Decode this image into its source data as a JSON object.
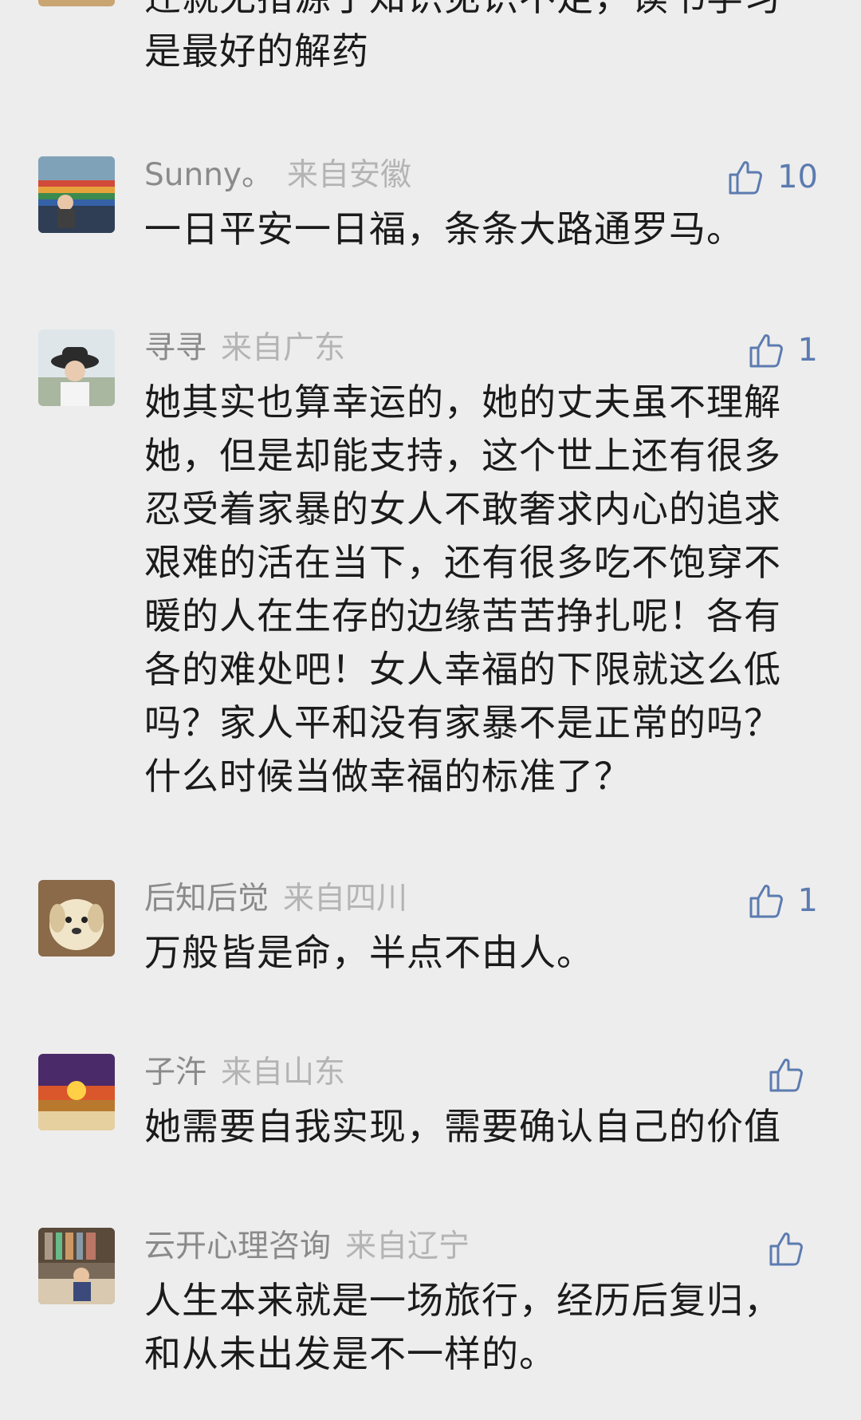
{
  "previous_comment": {
    "text": "迁就无措源于知识见识不足，读书学习\n是最好的解药"
  },
  "comments": [
    {
      "nickname": "Sunny。",
      "location": "来自安徽",
      "likes": "10",
      "text": "一日平安一日福，条条大路通罗马。"
    },
    {
      "nickname": "寻寻",
      "location": "来自广东",
      "likes": "1",
      "text": "她其实也算幸运的，她的丈夫虽不理解\n她，但是却能支持，这个世上还有很多\n忍受着家暴的女人不敢奢求内心的追求\n艰难的活在当下，还有很多吃不饱穿不\n暖的人在生存的边缘苦苦挣扎呢！各有\n各的难处吧！女人幸福的下限就这么低\n吗？家人平和没有家暴不是正常的吗？\n什么时候当做幸福的标准了？"
    },
    {
      "nickname": "后知后觉",
      "location": "来自四川",
      "likes": "1",
      "text": "万般皆是命，半点不由人。"
    },
    {
      "nickname": "子汻",
      "location": "来自山东",
      "likes": "",
      "text": "她需要自我实现，需要确认自己的价值"
    },
    {
      "nickname": "云开心理咨询",
      "location": "来自辽宁",
      "likes": "",
      "text": "人生本来就是一场旅行，经历后复归，\n和从未出发是不一样的。"
    }
  ],
  "icons": {
    "like": "thumbs-up-icon"
  },
  "colors": {
    "background": "#ededed",
    "nickname": "#8a8a8a",
    "location": "#b4b4b4",
    "like": "#5c7bb0",
    "text": "#1b1b1b"
  }
}
